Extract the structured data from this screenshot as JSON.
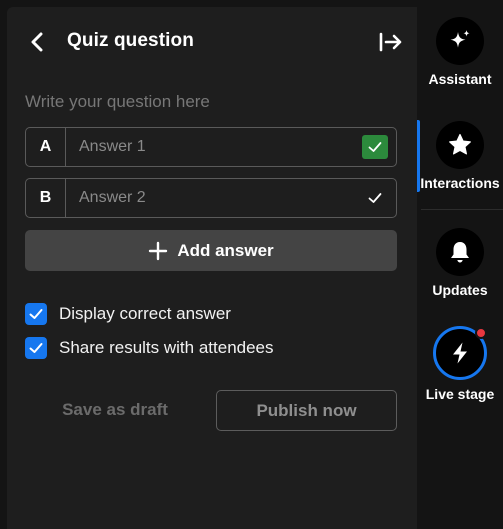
{
  "header": {
    "title": "Quiz question"
  },
  "question": {
    "placeholder": "Write your question here",
    "value": ""
  },
  "answers": [
    {
      "letter": "A",
      "placeholder": "Answer 1",
      "marked_correct": true
    },
    {
      "letter": "B",
      "placeholder": "Answer 2",
      "marked_correct": false
    }
  ],
  "add_answer_label": "Add answer",
  "options": {
    "display_correct_answer": {
      "label": "Display correct answer",
      "checked": true
    },
    "share_results": {
      "label": "Share results with attendees",
      "checked": true
    }
  },
  "actions": {
    "save_draft_label": "Save as draft",
    "publish_label": "Publish now"
  },
  "sidebar": {
    "items": [
      {
        "label": "Assistant",
        "icon": "sparkle-icon"
      },
      {
        "label": "Interactions",
        "icon": "star-icon",
        "active": true
      },
      {
        "label": "Updates",
        "icon": "bell-icon"
      },
      {
        "label": "Live stage",
        "icon": "lightning-icon",
        "live_indicator": true
      }
    ]
  },
  "colors": {
    "accent": "#1677ef",
    "correct_green": "#2c8a3c",
    "live_dot": "#e8373f",
    "panel_bg": "#1e1e1e",
    "sidebar_bg": "#141414"
  }
}
